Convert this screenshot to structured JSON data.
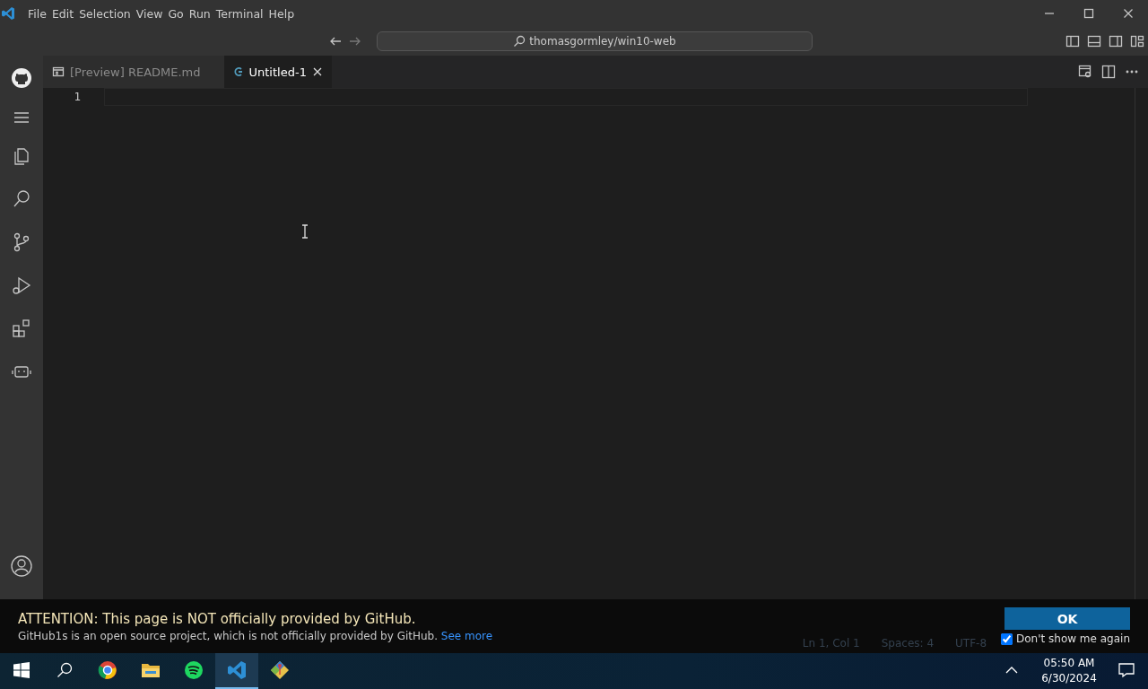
{
  "window": {
    "menu": [
      "File",
      "Edit",
      "Selection",
      "View",
      "Go",
      "Run",
      "Terminal",
      "Help"
    ],
    "search": {
      "value": "thomasgormley/win10-web"
    }
  },
  "tabs": [
    {
      "label": "[Preview] README.md",
      "kind": "preview",
      "selected": false
    },
    {
      "label": "Untitled-1",
      "kind": "text",
      "selected": true
    }
  ],
  "editor": {
    "line_numbers": [
      "1"
    ]
  },
  "status_bar": {
    "items": [
      "Ln 1, Col 1",
      "Spaces: 4",
      "UTF-8"
    ]
  },
  "banner": {
    "title": "ATTENTION: This page is NOT officially provided by GitHub.",
    "message": "GitHub1s is an open source project, which is not officially provided by GitHub.",
    "link": "See more",
    "button": "OK",
    "checkbox": {
      "label": "Don't show me again",
      "checked": true
    }
  },
  "taskbar": {
    "apps": [
      {
        "kind": "chrome",
        "selected": false
      },
      {
        "kind": "folder",
        "selected": false
      },
      {
        "kind": "music",
        "selected": false
      },
      {
        "kind": "vscode",
        "selected": true
      },
      {
        "kind": "git",
        "selected": false
      }
    ],
    "time": "05:50 AM",
    "date": "6/30/2024"
  }
}
